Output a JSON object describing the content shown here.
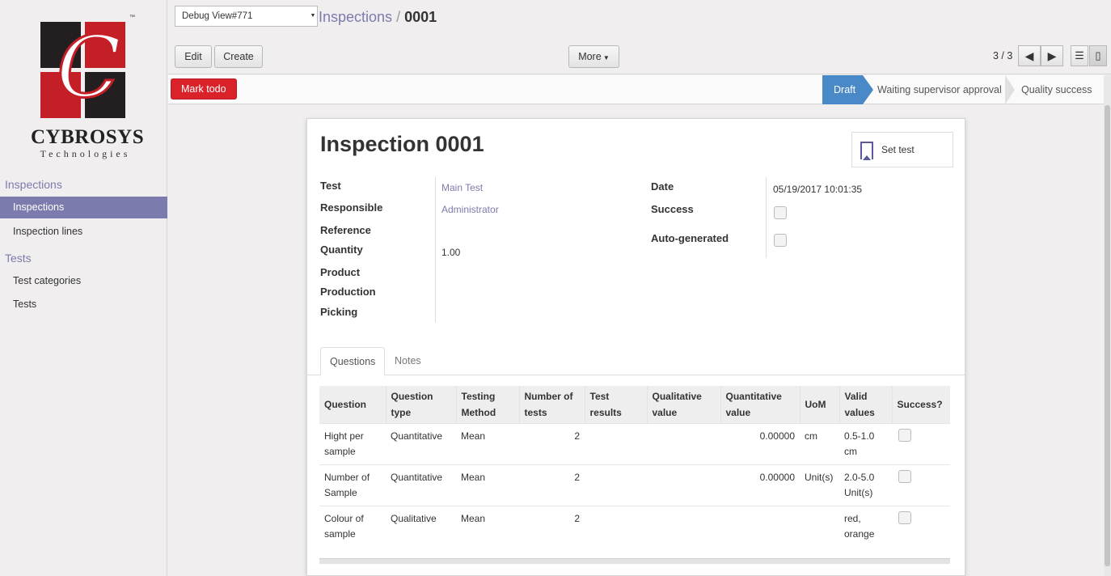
{
  "logo": {
    "name": "CYBROSYS",
    "sub": "Technologies",
    "tm": "™",
    "glyph": "C"
  },
  "sidebar": {
    "sections": [
      {
        "title": "Inspections",
        "items": [
          "Inspections",
          "Inspection lines"
        ]
      },
      {
        "title": "Tests",
        "items": [
          "Test categories",
          "Tests"
        ]
      }
    ]
  },
  "header": {
    "debug_select": "Debug View#771",
    "breadcrumb_parent": "Inspections",
    "breadcrumb_sep": "/",
    "breadcrumb_current": "0001",
    "edit_label": "Edit",
    "create_label": "Create",
    "more_label": "More",
    "pager": "3 / 3"
  },
  "statusbar": {
    "mark_todo": "Mark todo",
    "stages": [
      "Draft",
      "Waiting supervisor approval",
      "Quality success"
    ],
    "active_stage": "Draft"
  },
  "form": {
    "title": "Inspection 0001",
    "set_test": "Set test",
    "left_fields": [
      {
        "label": "Test",
        "value": "Main Test"
      },
      {
        "label": "Responsible",
        "value": "Administrator"
      },
      {
        "label": "Reference",
        "value": ""
      },
      {
        "label": "Quantity",
        "value": "1.00"
      },
      {
        "label": "Product",
        "value": ""
      },
      {
        "label": "Production",
        "value": ""
      },
      {
        "label": "Picking",
        "value": ""
      }
    ],
    "right_fields": [
      {
        "label": "Date",
        "value": "05/19/2017 10:01:35"
      },
      {
        "label": "Success",
        "value": false
      },
      {
        "label": "Auto-generated",
        "value": false
      }
    ],
    "tabs": [
      "Questions",
      "Notes"
    ],
    "active_tab": "Questions"
  },
  "questions": {
    "headers": [
      "Question",
      "Question type",
      "Testing Method",
      "Number of tests",
      "Test results",
      "Qualitative value",
      "Quantitative value",
      "UoM",
      "Valid values",
      "Success?"
    ],
    "rows": [
      {
        "question": "Hight per sample",
        "type": "Quantitative",
        "method": "Mean",
        "num_tests": "2",
        "test_results": "",
        "qualitative": "",
        "quantitative": "0.00000",
        "uom": "cm",
        "valid": "0.5-1.0 cm",
        "success": false
      },
      {
        "question": "Number of Sample",
        "type": "Quantitative",
        "method": "Mean",
        "num_tests": "2",
        "test_results": "",
        "qualitative": "",
        "quantitative": "0.00000",
        "uom": "Unit(s)",
        "valid": "2.0-5.0 Unit(s)",
        "success": false
      },
      {
        "question": "Colour of sample",
        "type": "Qualitative",
        "method": "Mean",
        "num_tests": "2",
        "test_results": "",
        "qualitative": "",
        "quantitative": "",
        "uom": "",
        "valid": "red, orange",
        "success": false
      }
    ]
  },
  "colors": {
    "accent": "#7c7bad",
    "todo": "#d9222a",
    "stage_active": "#4a89c8",
    "brand_red": "#c41f26",
    "brand_dark": "#231f20"
  }
}
